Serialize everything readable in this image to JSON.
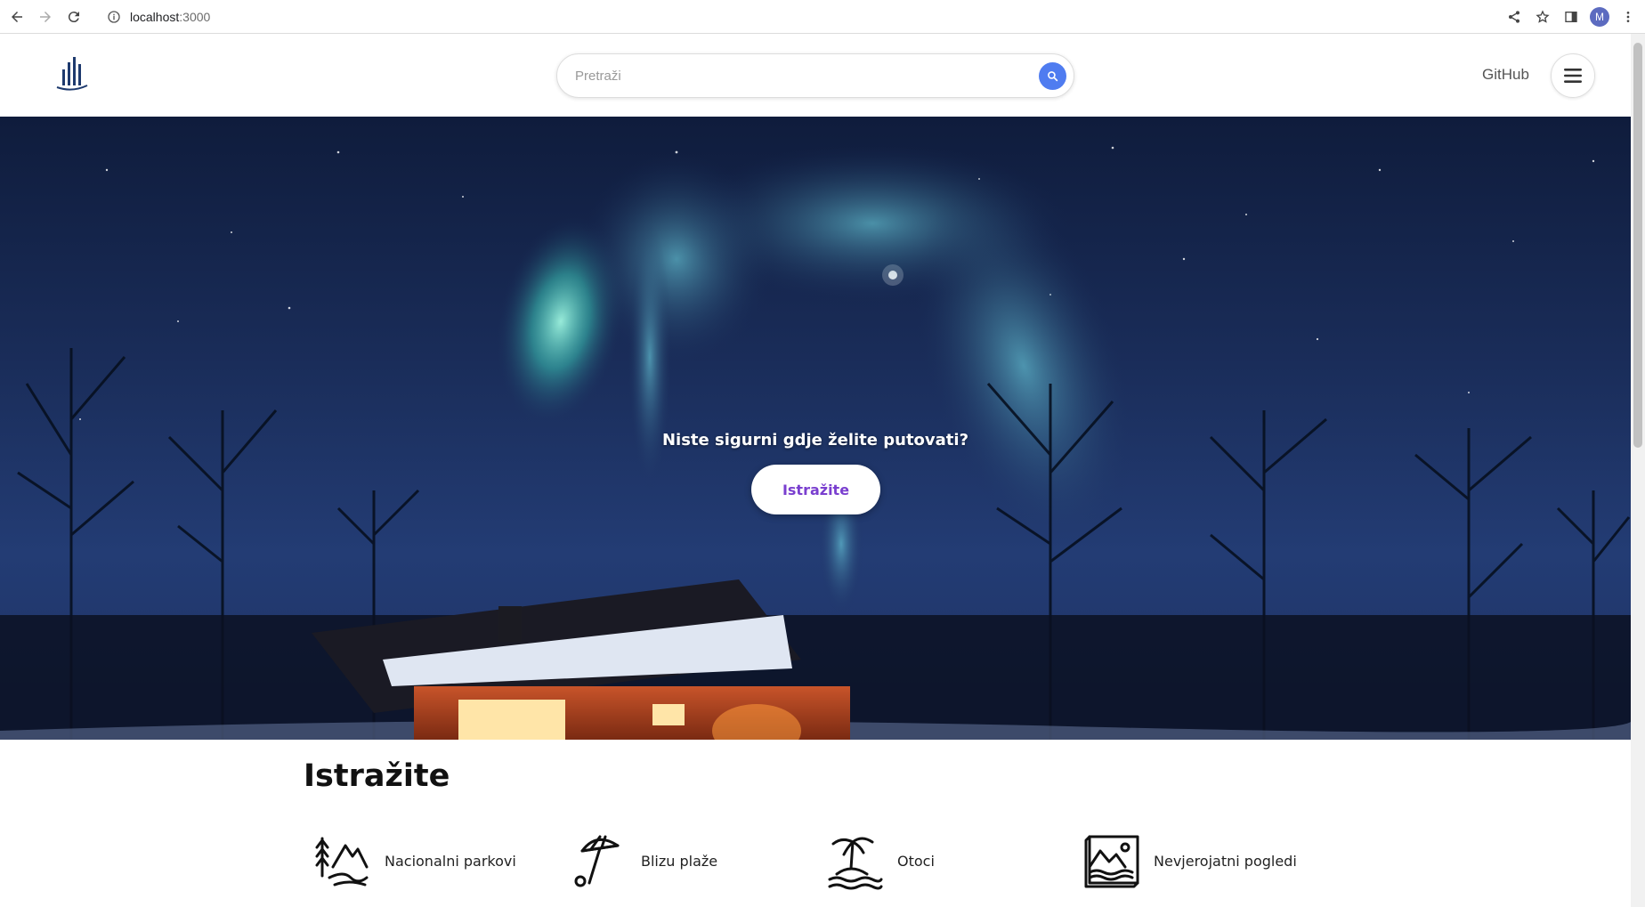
{
  "browser": {
    "url_host": "localhost",
    "url_port": ":3000",
    "avatar_letter": "M"
  },
  "header": {
    "search_placeholder": "Pretraži",
    "github_label": "GitHub"
  },
  "hero": {
    "heading": "Niste sigurni gdje želite putovati?",
    "button_label": "Istražite"
  },
  "explore": {
    "title": "Istražite",
    "categories": [
      {
        "label": "Nacionalni parkovi",
        "icon": "national-park-icon"
      },
      {
        "label": "Blizu plaže",
        "icon": "beach-umbrella-icon"
      },
      {
        "label": "Otoci",
        "icon": "island-icon"
      },
      {
        "label": "Nevjerojatni pogledi",
        "icon": "amazing-view-icon"
      }
    ]
  },
  "colors": {
    "accent": "#4f7cf0",
    "hero_button_text": "#7a3fcf"
  }
}
